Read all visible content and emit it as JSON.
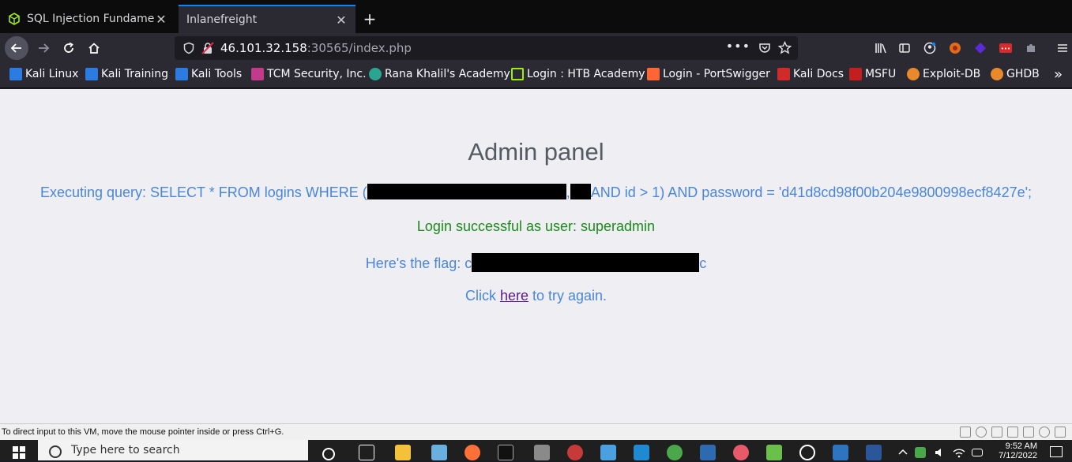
{
  "tabs": [
    {
      "label": "SQL Injection Fundament",
      "active": false
    },
    {
      "label": "Inlanefreight",
      "active": true
    }
  ],
  "newtab_symbol": "+",
  "nav": {
    "url_host": "46.101.32.158",
    "url_rest": ":30565/index.php",
    "dots": "•••"
  },
  "bookmarks": [
    {
      "label": "Kali Linux",
      "color": "#2b7be0"
    },
    {
      "label": "Kali Training",
      "color": "#2b7be0"
    },
    {
      "label": "Kali Tools",
      "color": "#2b7be0"
    },
    {
      "label": "TCM Security, Inc.",
      "color": "#c23b8a"
    },
    {
      "label": "Rana Khalil's Academy",
      "color": "#2aa58f"
    },
    {
      "label": "Login : HTB Academy",
      "color": "#9fef00"
    },
    {
      "label": "Login - PortSwigger",
      "color": "#ff6633"
    },
    {
      "label": "Kali Docs",
      "color": "#d02a2a"
    },
    {
      "label": "MSFU",
      "color": "#c41e1e"
    },
    {
      "label": "Exploit-DB",
      "color": "#e8892c"
    },
    {
      "label": "GHDB",
      "color": "#e8892c"
    }
  ],
  "page": {
    "title": "Admin panel",
    "query_prefix": "Executing query: SELECT * FROM logins WHERE (",
    "query_suffix": "AND id > 1) AND password = 'd41d8cd98f00b204e9800998ecf8427e';",
    "success": "Login successful as user: superadmin",
    "flag_prefix": "Here's the flag: c",
    "flag_suffix": "c",
    "again_prefix": "Click ",
    "again_link": "here",
    "again_suffix": " to try again."
  },
  "vm_status": "To direct input to this VM, move the mouse pointer inside or press Ctrl+G.",
  "taskbar": {
    "search_placeholder": "Type here to search",
    "time": "9:52 AM",
    "date": "7/12/2022"
  },
  "colors": {
    "accent": "#0a84ff",
    "query_text": "#4a86d8",
    "success_text": "#1b8a1b",
    "link_visited": "#5a1a8a"
  }
}
